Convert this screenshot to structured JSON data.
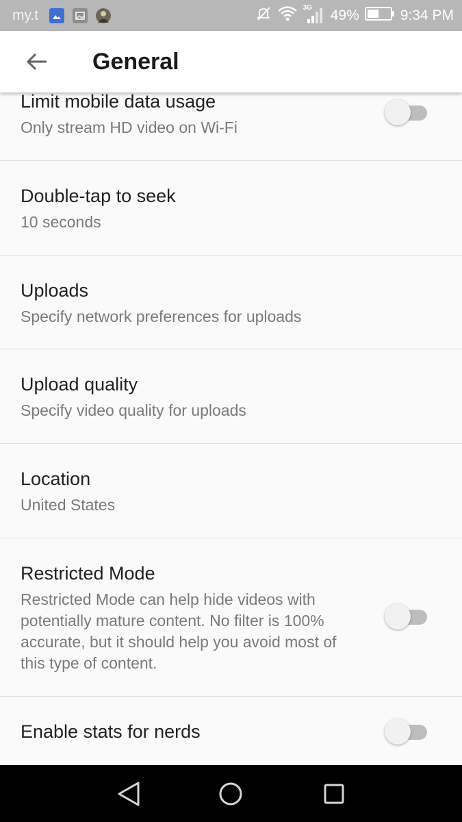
{
  "status_bar": {
    "carrier": "my.t",
    "network_type": "3G",
    "battery_percent": "49%",
    "time": "9:34 PM",
    "icons": [
      "image-notification-icon",
      "gallery-notification-icon",
      "avatar-notification-icon",
      "mute-icon",
      "wifi-icon",
      "signal-icon",
      "battery-icon"
    ]
  },
  "app_bar": {
    "title": "General",
    "back_icon": "arrow-back-icon"
  },
  "settings": [
    {
      "title": "Limit mobile data usage",
      "subtitle": "Only stream HD video on Wi-Fi",
      "toggle": true,
      "toggle_on": false
    },
    {
      "title": "Double-tap to seek",
      "subtitle": "10 seconds",
      "toggle": false
    },
    {
      "title": "Uploads",
      "subtitle": "Specify network preferences for uploads",
      "toggle": false
    },
    {
      "title": "Upload quality",
      "subtitle": "Specify video quality for uploads",
      "toggle": false
    },
    {
      "title": "Location",
      "subtitle": "United States",
      "toggle": false
    },
    {
      "title": "Restricted Mode",
      "subtitle": "Restricted Mode can help hide videos with potentially mature content. No filter is 100% accurate, but it should help you avoid most of this type of content.",
      "toggle": true,
      "toggle_on": false
    },
    {
      "title": "Enable stats for nerds",
      "toggle": true,
      "toggle_on": false
    }
  ],
  "nav_bar": {
    "icons": [
      "back-triangle-icon",
      "home-circle-icon",
      "recents-square-icon"
    ]
  },
  "colors": {
    "status_bar_bg": "#b7b7b7",
    "app_bar_bg": "#ffffff",
    "page_bg": "#fafafa",
    "divider": "#dcdcdc",
    "toggle_track_off": "#bdbdbd",
    "toggle_thumb_off": "#f1f1f1",
    "nav_bar_bg": "#000000"
  }
}
